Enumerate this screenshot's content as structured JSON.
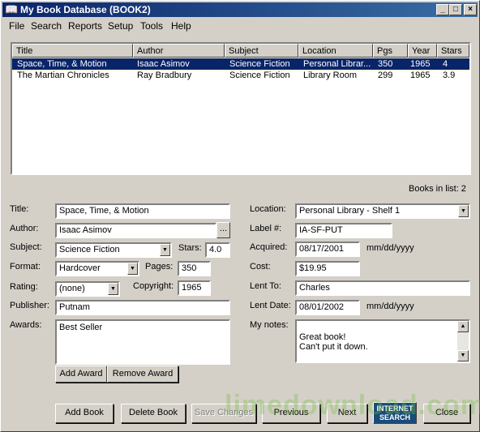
{
  "window": {
    "title": "My Book Database (BOOK2)"
  },
  "menu": [
    "File",
    "Search",
    "Reports",
    "Setup",
    "Tools",
    "Help"
  ],
  "list": {
    "columns": [
      "Title",
      "Author",
      "Subject",
      "Location",
      "Pgs",
      "Year",
      "Stars"
    ],
    "rows": [
      {
        "title": "Space, Time, & Motion",
        "author": "Isaac Asimov",
        "subject": "Science Fiction",
        "location": "Personal Librar...",
        "pgs": "350",
        "year": "1965",
        "stars": "4"
      },
      {
        "title": "The Martian Chronicles",
        "author": "Ray Bradbury",
        "subject": "Science Fiction",
        "location": "Library Room",
        "pgs": "299",
        "year": "1965",
        "stars": "3.9"
      }
    ]
  },
  "count_label": "Books in list: 2",
  "form": {
    "title_label": "Title:",
    "title": "Space, Time, & Motion",
    "author_label": "Author:",
    "author": "Isaac Asimov",
    "author_browse": "...",
    "subject_label": "Subject:",
    "subject": "Science Fiction",
    "stars_label": "Stars:",
    "stars": "4.0",
    "format_label": "Format:",
    "format": "Hardcover",
    "pages_label": "Pages:",
    "pages": "350",
    "rating_label": "Rating:",
    "rating": "(none)",
    "copyright_label": "Copyright:",
    "copyright": "1965",
    "publisher_label": "Publisher:",
    "publisher": "Putnam",
    "awards_label": "Awards:",
    "awards": "Best Seller",
    "add_award": "Add Award",
    "remove_award": "Remove Award",
    "location_label": "Location:",
    "location": "Personal Library - Shelf 1",
    "labelno_label": "Label #:",
    "labelno": "IA-SF-PUT",
    "acquired_label": "Acquired:",
    "acquired": "08/17/2001",
    "acquired_fmt": "mm/dd/yyyy",
    "cost_label": "Cost:",
    "cost": "$19.95",
    "lentto_label": "Lent To:",
    "lentto": "Charles",
    "lentdate_label": "Lent Date:",
    "lentdate": "08/01/2002",
    "lentdate_fmt": "mm/dd/yyyy",
    "notes_label": "My notes:",
    "notes": "Great book!\nCan't put it down."
  },
  "buttons": {
    "add": "Add Book",
    "delete": "Delete Book",
    "save": "Save Changes",
    "previous": "Previous",
    "next": "Next",
    "internet": "INTERNET SEARCH",
    "close": "Close"
  },
  "watermark": "limedownload.com",
  "icons": {
    "app": "book-icon"
  }
}
